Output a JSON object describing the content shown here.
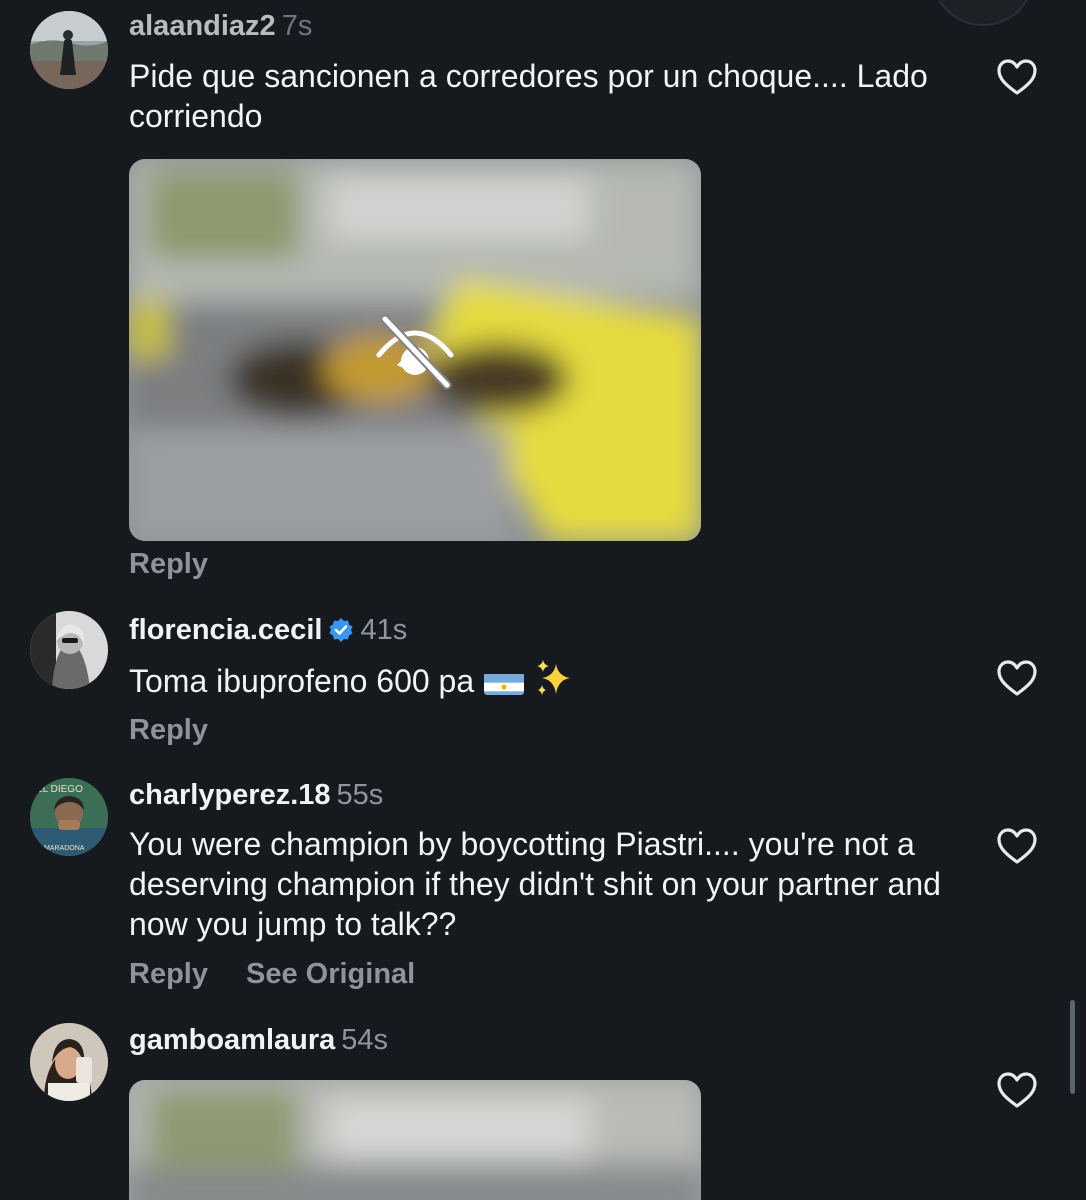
{
  "comments": [
    {
      "username": "alaandiaz2",
      "time": "7s",
      "text": "Pide que sancionen a corredores por un choque.... Lado corriendo",
      "reply_label": "Reply"
    },
    {
      "username": "florencia.cecil",
      "time": "41s",
      "verified": true,
      "text": "Toma ibuprofeno 600 pa",
      "emojis": [
        "argentina-flag",
        "sparkles"
      ],
      "reply_label": "Reply"
    },
    {
      "username": "charlyperez.18",
      "time": "55s",
      "text": "You were champion by boycotting Piastri.... you're not a deserving champion if they didn't shit on your partner and now you jump to talk??",
      "reply_label": "Reply",
      "see_original_label": "See Original",
      "avatar_text": [
        "EL DIEGO",
        "MARADONA"
      ]
    },
    {
      "username": "gamboamlaura",
      "time": "54s"
    }
  ],
  "colors": {
    "background": "#16191d",
    "secondary_text": "#8f96a0",
    "verified_blue": "#3897f0",
    "heart_stroke": "#e9eaec"
  },
  "icons": [
    "heart-icon",
    "hidden-content-icon",
    "verified-badge-icon"
  ]
}
